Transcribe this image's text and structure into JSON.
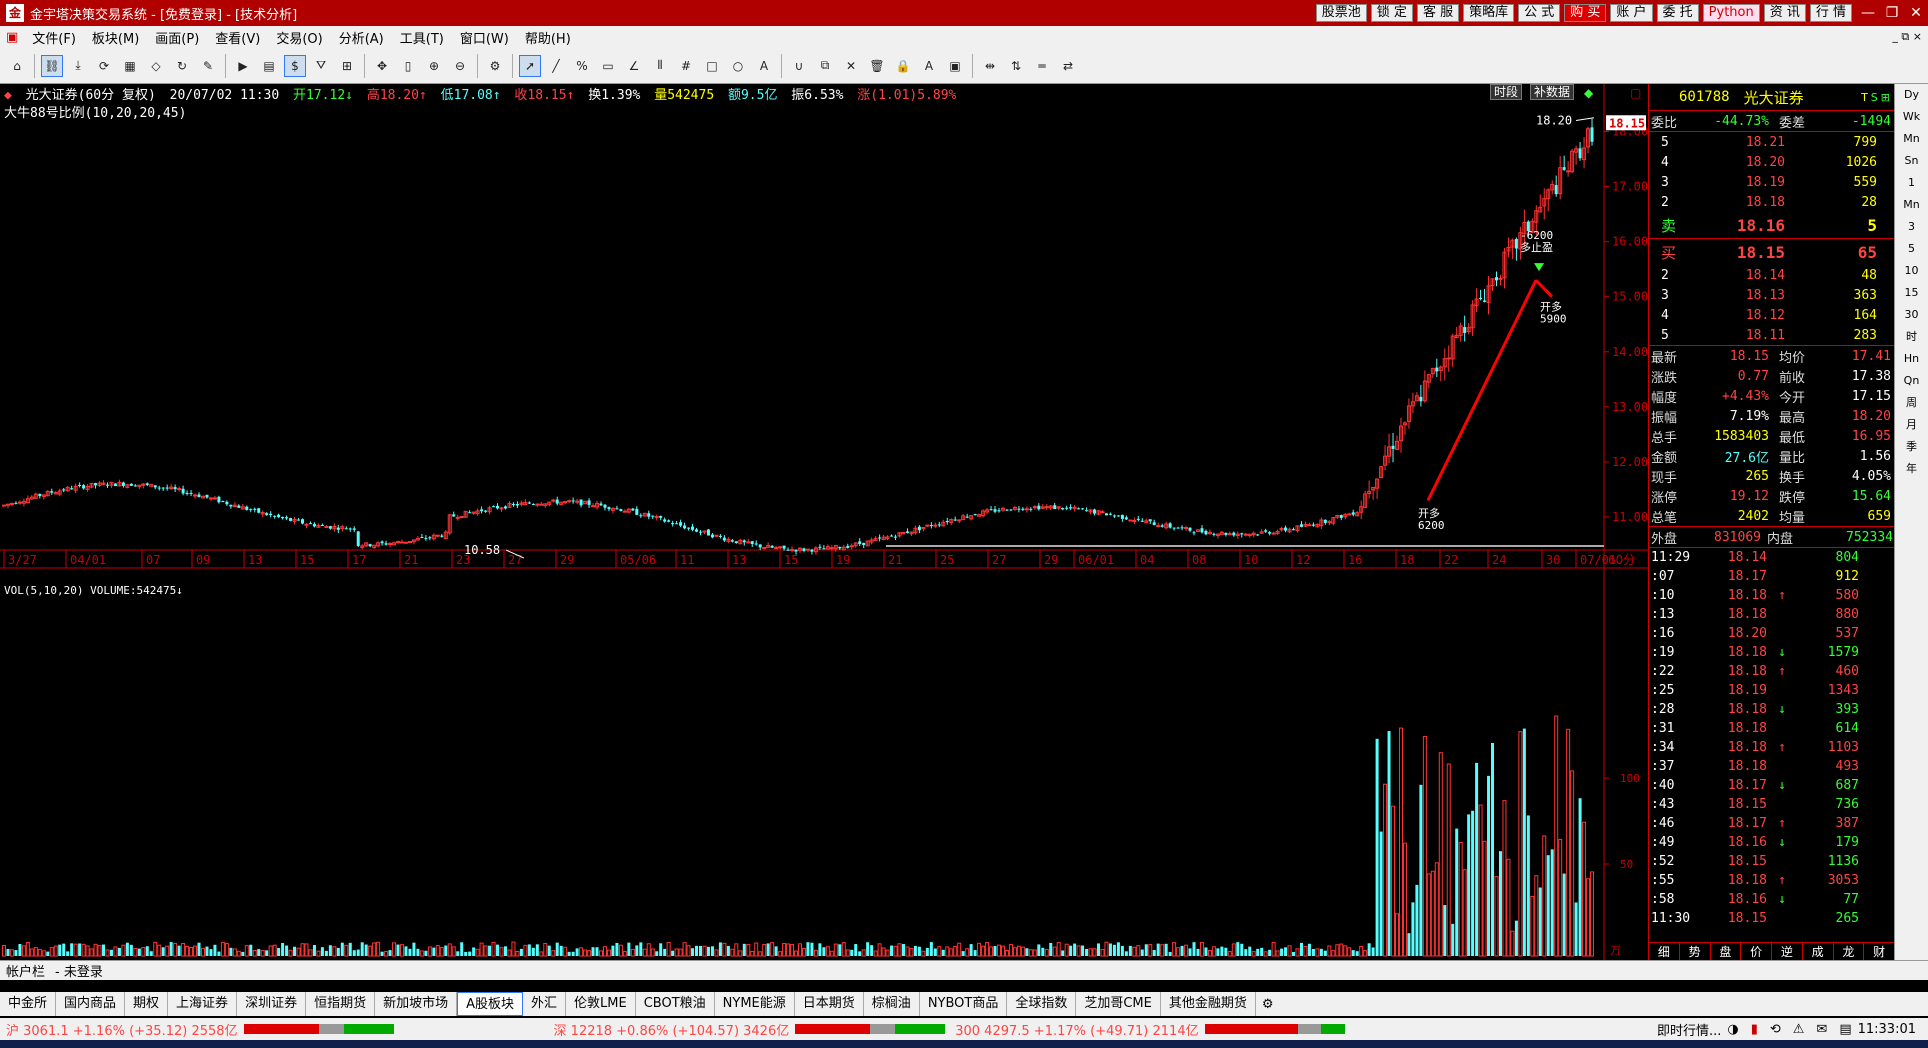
{
  "titlebar": {
    "app_icon": "金",
    "title": "金宇塔决策交易系统 - [免费登录] - [技术分析]",
    "buttons": [
      "股票池",
      "锁 定",
      "客 服",
      "策略库",
      "公 式",
      "购 买",
      "账 户",
      "委 托",
      "Python",
      "资 讯",
      "行 情"
    ],
    "minimize": "—",
    "restore": "❐",
    "close": "✕"
  },
  "menu": {
    "items": [
      "文件(F)",
      "板块(M)",
      "画面(P)",
      "查看(V)",
      "交易(O)",
      "分析(A)",
      "工具(T)",
      "窗口(W)",
      "帮助(H)"
    ],
    "right": "_ ⧉ ×"
  },
  "infobar": {
    "name": "光大证券(60分 复权)",
    "date": "20/07/02 11:30",
    "open": "开17.12↓",
    "high": "高18.20↑",
    "low": "低17.08↑",
    "close": "收18.15↑",
    "turnover": "换1.39%",
    "volume": "量542475",
    "amount": "额9.5亿",
    "amplitude": "振6.53%",
    "change": "涨(1.01)5.89%"
  },
  "ma_line": "大牛88号比例(10,20,20,45)",
  "chart_buttons": {
    "period": "时段",
    "fill": "补数据"
  },
  "chart_data": {
    "type": "candlestick",
    "period": "60分",
    "y_ticks": [
      "18.00",
      "17.00",
      "16.00",
      "15.00",
      "14.00",
      "13.00",
      "12.00",
      "11.00"
    ],
    "price_label": "18.15",
    "high_label": "18.20",
    "low_label": "10.58",
    "x_ticks": [
      "3/27",
      "04/01",
      "07",
      "09",
      "13",
      "15",
      "17",
      "21",
      "23",
      "27",
      "29",
      "05/06",
      "11",
      "13",
      "15",
      "19",
      "21",
      "25",
      "27",
      "29",
      "06/01",
      "04",
      "08",
      "10",
      "12",
      "16",
      "18",
      "22",
      "24",
      "30",
      "07/01"
    ],
    "x_unit": "60分",
    "signals": [
      {
        "text1": "开多",
        "text2": "6200"
      },
      {
        "text1": "-6200",
        "text2": "多止盈"
      },
      {
        "text1": "开多",
        "text2": "5900"
      }
    ],
    "volume_title": "VOL(5,10,20) VOLUME:542475↓",
    "vol_ticks": [
      "100",
      "50"
    ],
    "vol_unit": "万"
  },
  "quote": {
    "code": "601788",
    "name": "光大证券",
    "weibi_label": "委比",
    "weibi": "-44.73%",
    "weicha_label": "委差",
    "weicha": "-1494",
    "sell": [
      {
        "lvl": "5",
        "price": "18.21",
        "vol": "799"
      },
      {
        "lvl": "4",
        "price": "18.20",
        "vol": "1026"
      },
      {
        "lvl": "3",
        "price": "18.19",
        "vol": "559"
      },
      {
        "lvl": "2",
        "price": "18.18",
        "vol": "28"
      },
      {
        "lvl": "卖",
        "price": "18.16",
        "vol": "5"
      }
    ],
    "buy": [
      {
        "lvl": "买",
        "price": "18.15",
        "vol": "65"
      },
      {
        "lvl": "2",
        "price": "18.14",
        "vol": "48"
      },
      {
        "lvl": "3",
        "price": "18.13",
        "vol": "363"
      },
      {
        "lvl": "4",
        "price": "18.12",
        "vol": "164"
      },
      {
        "lvl": "5",
        "price": "18.11",
        "vol": "283"
      }
    ],
    "stats": [
      {
        "l1": "最新",
        "v1": "18.15",
        "c1": "red",
        "l2": "均价",
        "v2": "17.41",
        "c2": "red"
      },
      {
        "l1": "涨跌",
        "v1": "0.77",
        "c1": "red",
        "l2": "前收",
        "v2": "17.38",
        "c2": "white"
      },
      {
        "l1": "幅度",
        "v1": "+4.43%",
        "c1": "red",
        "l2": "今开",
        "v2": "17.15",
        "c2": "white"
      },
      {
        "l1": "振幅",
        "v1": "7.19%",
        "c1": "white",
        "l2": "最高",
        "v2": "18.20",
        "c2": "red"
      },
      {
        "l1": "总手",
        "v1": "1583403",
        "c1": "yellow",
        "l2": "最低",
        "v2": "16.95",
        "c2": "red"
      },
      {
        "l1": "金额",
        "v1": "27.6亿",
        "c1": "cyan",
        "l2": "量比",
        "v2": "1.56",
        "c2": "white"
      },
      {
        "l1": "现手",
        "v1": "265",
        "c1": "yellow",
        "l2": "换手",
        "v2": "4.05%",
        "c2": "white"
      },
      {
        "l1": "涨停",
        "v1": "19.12",
        "c1": "red",
        "l2": "跌停",
        "v2": "15.64",
        "c2": "green"
      },
      {
        "l1": "总笔",
        "v1": "2402",
        "c1": "yellow",
        "l2": "均量",
        "v2": "659",
        "c2": "yellow"
      }
    ],
    "outer_label": "外盘",
    "outer": "831069",
    "inner_label": "内盘",
    "inner": "752334",
    "ticks": [
      {
        "t": "11:29",
        "p": "18.14",
        "a": "",
        "v": "804",
        "vc": "green"
      },
      {
        "t": ":07",
        "p": "18.17",
        "a": "",
        "v": "912",
        "vc": "yellow"
      },
      {
        "t": ":10",
        "p": "18.18",
        "a": "↑",
        "v": "580",
        "vc": "red"
      },
      {
        "t": ":13",
        "p": "18.18",
        "a": "",
        "v": "880",
        "vc": "red"
      },
      {
        "t": ":16",
        "p": "18.20",
        "a": "",
        "v": "537",
        "vc": "red"
      },
      {
        "t": ":19",
        "p": "18.18",
        "a": "↓",
        "v": "1579",
        "vc": "green"
      },
      {
        "t": ":22",
        "p": "18.18",
        "a": "↑",
        "v": "460",
        "vc": "red"
      },
      {
        "t": ":25",
        "p": "18.19",
        "a": "",
        "v": "1343",
        "vc": "red"
      },
      {
        "t": ":28",
        "p": "18.18",
        "a": "↓",
        "v": "393",
        "vc": "green"
      },
      {
        "t": ":31",
        "p": "18.18",
        "a": "",
        "v": "614",
        "vc": "green"
      },
      {
        "t": ":34",
        "p": "18.18",
        "a": "↑",
        "v": "1103",
        "vc": "red"
      },
      {
        "t": ":37",
        "p": "18.18",
        "a": "",
        "v": "493",
        "vc": "red"
      },
      {
        "t": ":40",
        "p": "18.17",
        "a": "↓",
        "v": "687",
        "vc": "green"
      },
      {
        "t": ":43",
        "p": "18.15",
        "a": "",
        "v": "736",
        "vc": "green"
      },
      {
        "t": ":46",
        "p": "18.17",
        "a": "↑",
        "v": "387",
        "vc": "red"
      },
      {
        "t": ":49",
        "p": "18.16",
        "a": "↓",
        "v": "179",
        "vc": "green"
      },
      {
        "t": ":52",
        "p": "18.15",
        "a": "",
        "v": "1136",
        "vc": "green"
      },
      {
        "t": ":55",
        "p": "18.18",
        "a": "↑",
        "v": "3053",
        "vc": "red"
      },
      {
        "t": ":58",
        "p": "18.16",
        "a": "↓",
        "v": "77",
        "vc": "green"
      },
      {
        "t": "11:30",
        "p": "18.15",
        "a": "",
        "v": "265",
        "vc": "green"
      }
    ],
    "bottom_tabs": [
      "细",
      "势",
      "盘",
      "价",
      "逆",
      "成",
      "龙",
      "财"
    ]
  },
  "sidestrip": [
    "Dy",
    "Wk",
    "Mn",
    "Sn",
    "1",
    "Mn",
    "3",
    "5",
    "10",
    "15",
    "30",
    "时",
    "Hn",
    "Qn",
    "周",
    "月",
    "季",
    "年"
  ],
  "account": {
    "label": "帐户栏",
    "status": "- 未登录"
  },
  "market_tabs": [
    "中金所",
    "国内商品",
    "期权",
    "上海证券",
    "深圳证券",
    "恒指期货",
    "新加坡市场",
    "A股板块",
    "外汇",
    "伦敦LME",
    "CBOT粮油",
    "NYME能源",
    "日本期货",
    "棕榈油",
    "NYBOT商品",
    "全球指数",
    "芝加哥CME",
    "其他金融期货"
  ],
  "status": {
    "sh": "沪 3061.1 +1.16% (+35.12) 2558亿",
    "sz": "深 12218 +0.86% (+104.57) 3426亿",
    "hs300": "300 4297.5 +1.17% (+49.71) 2114亿",
    "realtime": "即时行情...",
    "time": "11:33:01"
  }
}
